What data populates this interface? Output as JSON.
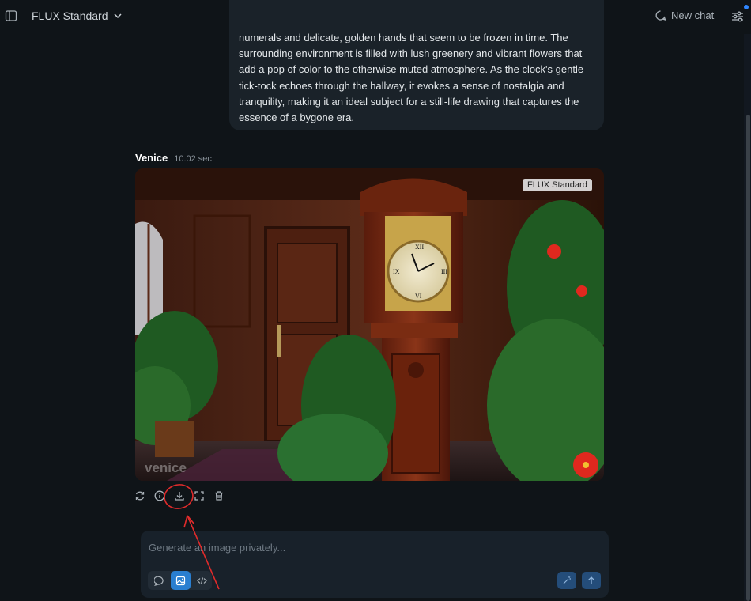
{
  "header": {
    "model_name": "FLUX Standard",
    "new_chat_label": "New chat"
  },
  "user_message": {
    "text": "numerals and delicate, golden hands that seem to be frozen in time. The surrounding environment is filled with lush greenery and vibrant flowers that add a pop of color to the otherwise muted atmosphere. As the clock's gentle tick-tock echoes through the hallway, it evokes a sense of nostalgia and tranquility, making it an ideal subject for a still-life drawing that captures the essence of a bygone era."
  },
  "assistant": {
    "name": "Venice",
    "time": "10.02 sec",
    "image_badge": "FLUX Standard",
    "watermark": "venice"
  },
  "actions": [
    "regenerate-icon",
    "info-icon",
    "download-icon",
    "fullscreen-icon",
    "trash-icon"
  ],
  "composer": {
    "placeholder": "Generate an image privately...",
    "value": ""
  },
  "colors": {
    "background": "#0f1418",
    "bubble": "#1a2229",
    "accent": "#2a7fd1",
    "annotation": "#e02b2b"
  }
}
